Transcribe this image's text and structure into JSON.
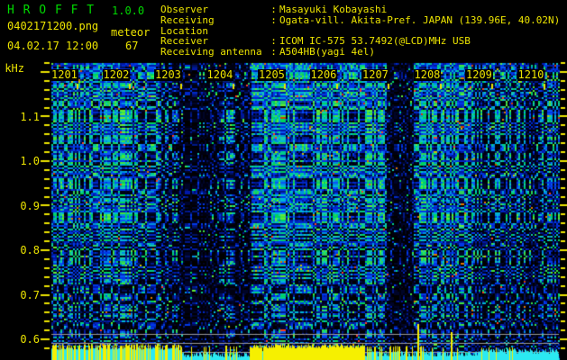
{
  "header": {
    "app_name": "H R O F F T",
    "version": "1.0.0",
    "filename": "0402171200.png",
    "mode": "meteor",
    "datetime": "04.02.17 12:00",
    "echo_count": "67",
    "separator": ":",
    "info": [
      {
        "label": "Observer",
        "value": "Masayuki Kobayashi"
      },
      {
        "label": "Receiving Location",
        "value": "Ogata-vill. Akita-Pref. JAPAN (139.96E, 40.02N)"
      },
      {
        "label": "Receiver",
        "value": "ICOM IC-575 53.7492(@LCD)MHz USB"
      },
      {
        "label": "Receiving antenna",
        "value": "A504HB(yagi 4el)"
      }
    ],
    "colors": {
      "title": "#00d900",
      "text": "#ece400"
    }
  },
  "chart_data": {
    "type": "heatmap",
    "title": "HROFFT radio meteor spectrogram 12:00-12:10",
    "x_ticks": [
      "1201",
      "1202",
      "1203",
      "1204",
      "1205",
      "1206",
      "1207",
      "1208",
      "1209",
      "1210"
    ],
    "y_axis_label": "kHz",
    "y_ticks": [
      "1.1",
      "1.0",
      "0.9",
      "0.8",
      "0.7",
      "0.6"
    ],
    "y_major_step_khz": 0.1,
    "y_minor_step_khz": 0.02,
    "y_range_khz": [
      0.56,
      1.22
    ],
    "x_range_time": [
      "12:00",
      "12:10"
    ],
    "reference_lines_khz": [
      0.612,
      0.592,
      0.572
    ],
    "grid": false,
    "legend": false,
    "colors": {
      "axis_tick": "#ece400",
      "reference_line": "#9a9a9a",
      "band_cyan": "#2be9f2",
      "band_yellow": "#f6f000",
      "noise_bright_green": [
        "#3fe63f",
        "#2ed157",
        "#63ec36"
      ],
      "noise_green_cyan": [
        "#00cf8a",
        "#14c9b4",
        "#00d45f"
      ],
      "noise_bright_blue": [
        "#0a55f5",
        "#008fe0",
        "#00b6d8"
      ],
      "noise_blue": [
        "#0028c8",
        "#0018a8",
        "#0038e8"
      ],
      "noise_dim_blue": [
        "#001060",
        "#001888"
      ],
      "noise_black": [
        "#000010",
        "#000428",
        "#000000"
      ],
      "noise_special": [
        "#d23c00",
        "#e07800",
        "#c8c800",
        "#ff4020"
      ]
    },
    "activity_profile": [
      {
        "from": 0.0,
        "to": 0.082,
        "intensity": 0.72,
        "approx_time": "12:00"
      },
      {
        "from": 0.082,
        "to": 0.144,
        "intensity": 0.82,
        "approx_time": "12:01"
      },
      {
        "from": 0.144,
        "to": 0.211,
        "intensity": 0.66,
        "approx_time": "12:02"
      },
      {
        "from": 0.211,
        "to": 0.247,
        "intensity": 0.34,
        "approx_time": "12:02"
      },
      {
        "from": 0.247,
        "to": 0.336,
        "intensity": 0.13,
        "approx_time": "12:03 quiet"
      },
      {
        "from": 0.336,
        "to": 0.357,
        "intensity": 0.4,
        "approx_time": "12:03"
      },
      {
        "from": 0.357,
        "to": 0.391,
        "intensity": 0.15,
        "approx_time": "12:04 quiet"
      },
      {
        "from": 0.391,
        "to": 0.503,
        "intensity": 0.95,
        "approx_time": "12:05 strong echo"
      },
      {
        "from": 0.503,
        "to": 0.659,
        "intensity": 0.83,
        "approx_time": "12:06 strong echo"
      },
      {
        "from": 0.659,
        "to": 0.712,
        "intensity": 0.07,
        "approx_time": "12:07 quiet"
      },
      {
        "from": 0.712,
        "to": 0.829,
        "intensity": 0.8,
        "approx_time": "12:08"
      },
      {
        "from": 0.829,
        "to": 0.868,
        "intensity": 0.46,
        "approx_time": "12:08"
      },
      {
        "from": 0.868,
        "to": 0.934,
        "intensity": 0.52,
        "approx_time": "12:09"
      },
      {
        "from": 0.934,
        "to": 0.964,
        "intensity": 0.3,
        "approx_time": "12:09"
      },
      {
        "from": 0.964,
        "to": 1.0,
        "intensity": 0.52,
        "approx_time": "12:10"
      }
    ],
    "vertical_fade": [
      {
        "from": 0.0,
        "to": 0.25,
        "factor": 1.0
      },
      {
        "from": 0.25,
        "to": 0.55,
        "factor": 0.88
      },
      {
        "from": 0.55,
        "to": 0.73,
        "factor": 0.68
      },
      {
        "from": 0.73,
        "to": 0.88,
        "factor": 0.52
      },
      {
        "from": 0.88,
        "to": 1.0,
        "factor": 0.38
      }
    ],
    "bottom_band": {
      "segments": [
        {
          "from": 0.0,
          "to": 0.255,
          "cyan_h": 11,
          "spike_density": 0.5,
          "spike_h": 15
        },
        {
          "from": 0.255,
          "to": 0.39,
          "cyan_h": 6,
          "spike_density": 0.1,
          "spike_h": 14
        },
        {
          "from": 0.39,
          "to": 0.617,
          "cyan_h": 9,
          "spike_density": 0.97,
          "spike_h": 15
        },
        {
          "from": 0.617,
          "to": 0.735,
          "cyan_h": 7,
          "spike_density": 0.25,
          "spike_h": 14
        },
        {
          "from": 0.735,
          "to": 0.845,
          "cyan_h": 7,
          "spike_density": 0.1,
          "spike_h": 13
        },
        {
          "from": 0.845,
          "to": 1.0,
          "cyan_h": 10,
          "spike_density": 0.1,
          "spike_h": 13
        }
      ],
      "tall_spikes": [
        {
          "frac": 0.343,
          "h": 16
        },
        {
          "frac": 0.721,
          "h": 40
        },
        {
          "frac": 0.787,
          "h": 31
        }
      ]
    }
  }
}
